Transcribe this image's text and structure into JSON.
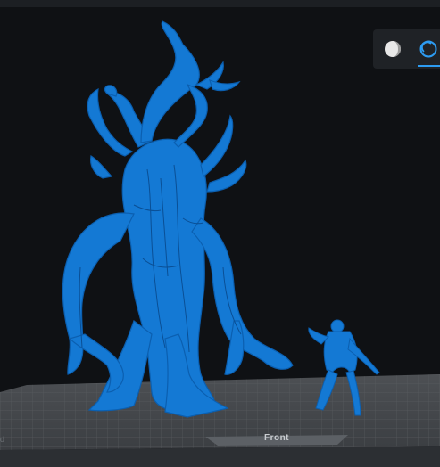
{
  "toolbar": {
    "shading_label": "shaded-view",
    "xray_label": "wireframe-view",
    "accent_color": "#2d9cf2"
  },
  "bed": {
    "front_label": "Front",
    "corner_text": "d"
  },
  "models": [
    {
      "name": "giant-tree-creature",
      "color": "#1479d4"
    },
    {
      "name": "small-warrior-figure",
      "color": "#1479d4"
    }
  ]
}
